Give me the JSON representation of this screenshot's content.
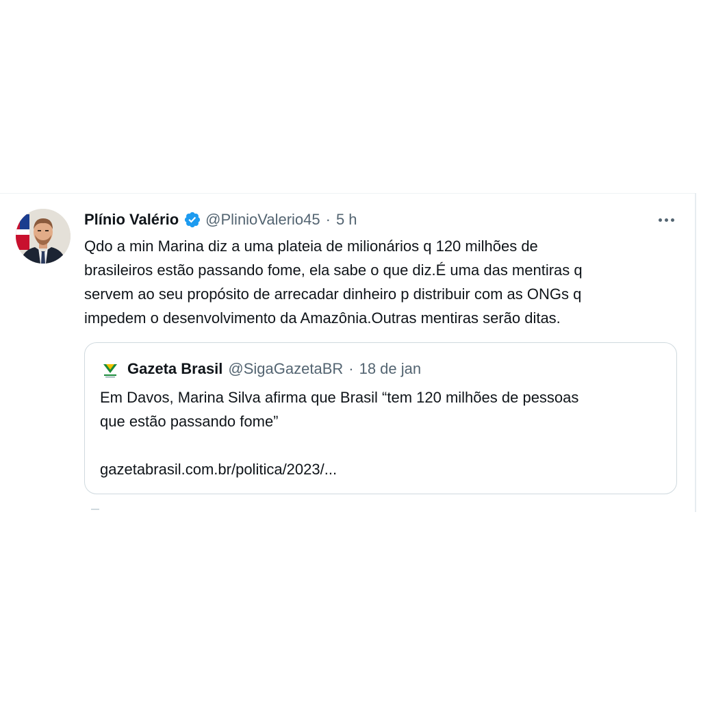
{
  "tweet": {
    "author_name": "Plínio Valério",
    "author_handle": "@PlinioValerio45",
    "separator": "·",
    "time": "5 h",
    "text_lines": [
      "Qdo a min Marina diz a uma plateia de milionários q 120 milhões de",
      "brasileiros estão passando fome, ela sabe o que diz.É uma das mentiras q",
      "servem ao seu propósito de arrecadar dinheiro p distribuir com as ONGs q",
      "impedem o desenvolvimento da Amazônia.Outras mentiras serão ditas."
    ],
    "verified": true,
    "more_icon": "more-horizontal-icon",
    "verified_icon": "verified-badge-icon"
  },
  "quoted_tweet": {
    "author_name": "Gazeta Brasil",
    "author_handle": "@SigaGazetaBR",
    "separator": "·",
    "date": "18 de jan",
    "text_lines": [
      "Em Davos, Marina Silva afirma que Brasil “tem 120 milhões de pessoas",
      "que estão passando fome”"
    ],
    "link": "gazetabrasil.com.br/politica/2023/...",
    "logo_icon": "gazeta-brasil-logo-icon"
  },
  "colors": {
    "text_primary": "#0f1419",
    "text_secondary": "#536471",
    "verified_blue": "#1d9bf0",
    "border": "#cfd9de"
  }
}
